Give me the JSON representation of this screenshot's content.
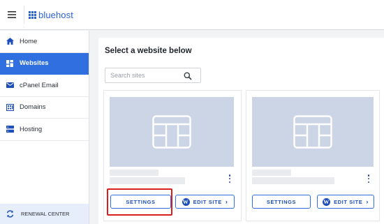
{
  "header": {
    "brand_name": "bluehost",
    "brand_color": "#2b62d4"
  },
  "sidebar": {
    "items": [
      {
        "label": "Home",
        "icon": "home-icon",
        "active": false
      },
      {
        "label": "Websites",
        "icon": "grid-icon",
        "active": true
      },
      {
        "label": "cPanel Email",
        "icon": "mail-icon",
        "active": false
      },
      {
        "label": "Domains",
        "icon": "domains-icon",
        "active": false
      },
      {
        "label": "Hosting",
        "icon": "hosting-icon",
        "active": false
      }
    ],
    "renewal_label": "RENEWAL CENTER",
    "active_color": "#2f6fe0"
  },
  "main": {
    "title": "Select a website below",
    "search": {
      "placeholder": "Search sites",
      "value": ""
    },
    "cards": [
      {
        "settings_label": "SETTINGS",
        "edit_label": "EDIT SITE",
        "highlighted": true
      },
      {
        "settings_label": "SETTINGS",
        "edit_label": "EDIT SITE",
        "highlighted": false
      }
    ]
  },
  "colors": {
    "highlight": "#d91e1e",
    "thumbnail": "#ccd5e6"
  }
}
